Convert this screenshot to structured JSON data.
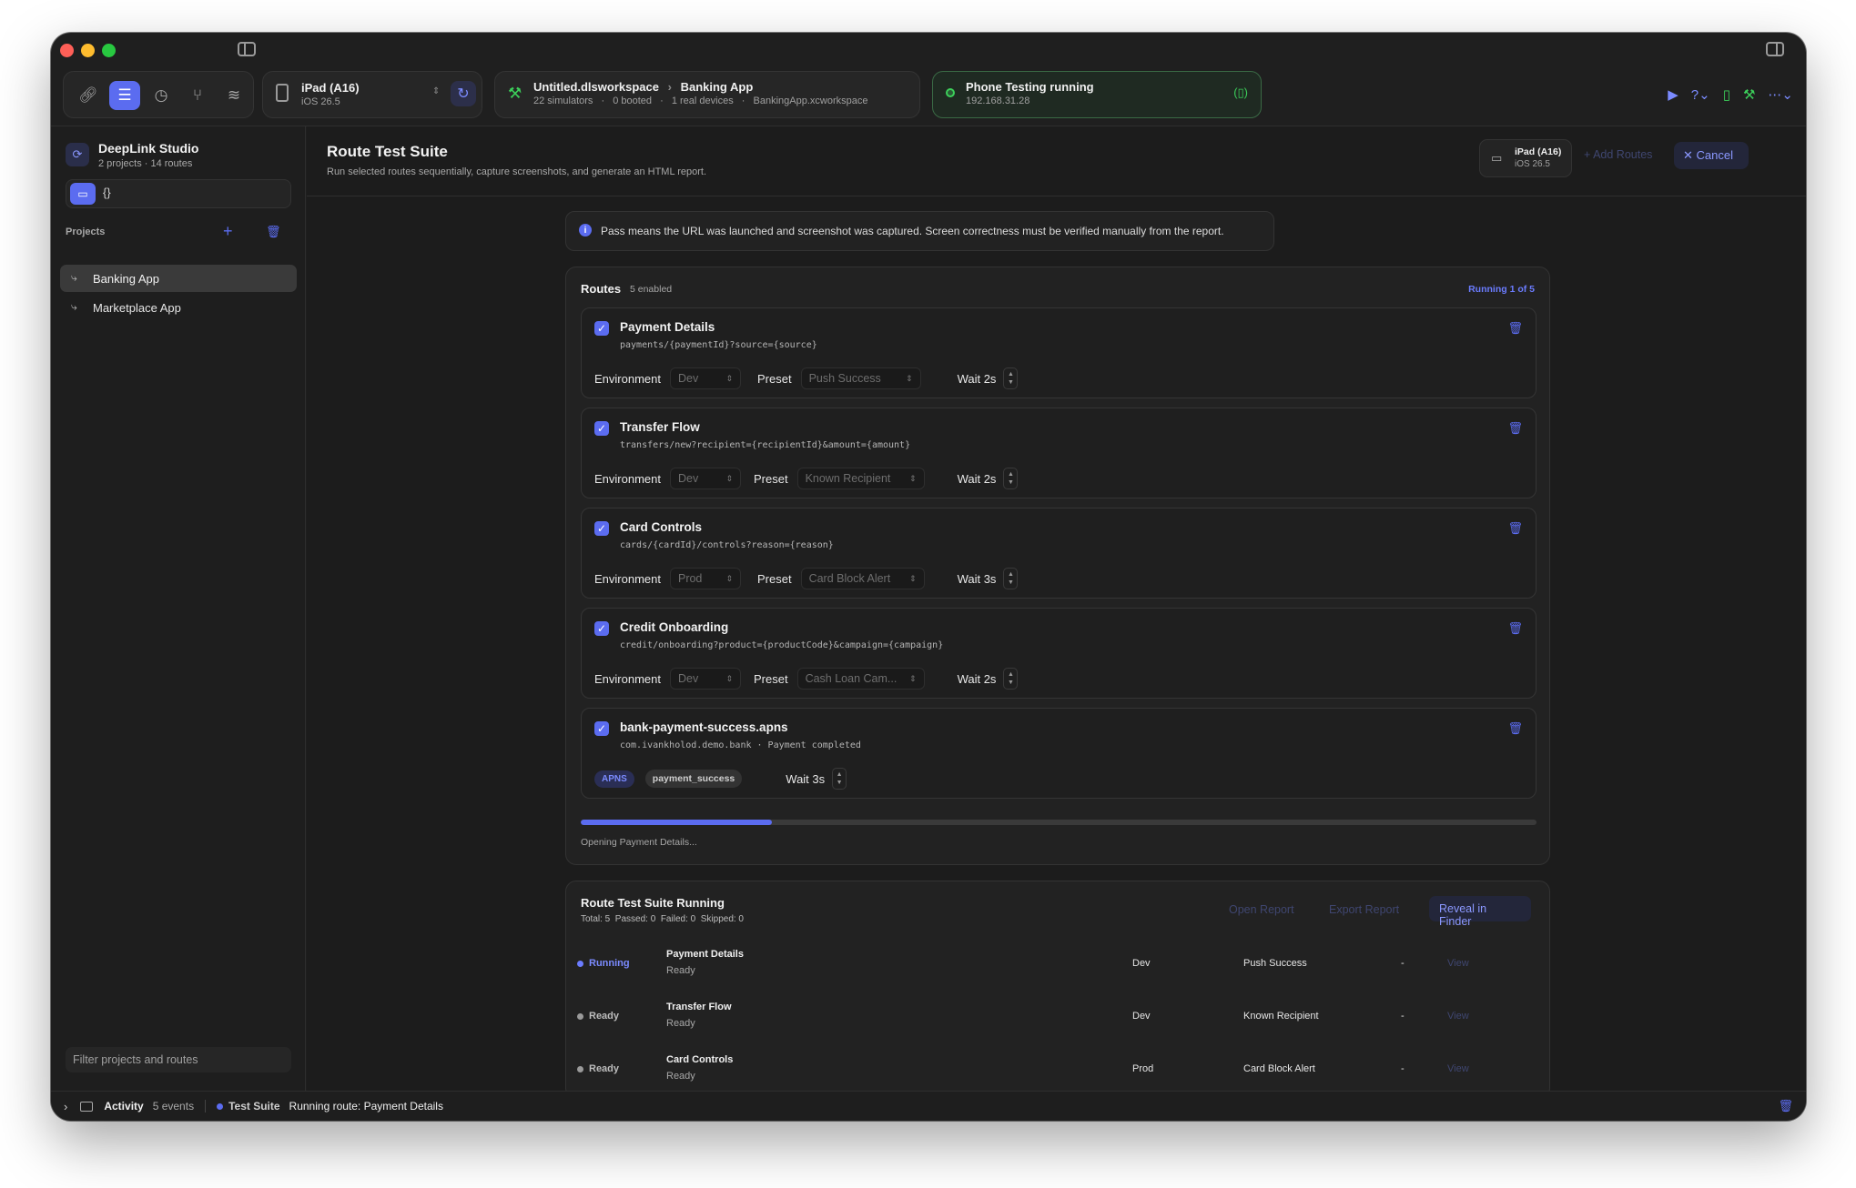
{
  "window": {
    "toolbar": {
      "device": {
        "name": "iPad (A16)",
        "os": "iOS 26.5"
      },
      "workspace": {
        "name": "Untitled.dlsworkspace",
        "project": "Banking App",
        "simulators": "22 simulators",
        "booted": "0 booted",
        "real_devices": "1 real devices",
        "xcworkspace": "BankingApp.xcworkspace"
      },
      "phone_testing": {
        "title": "Phone Testing running",
        "ip": "192.168.31.28"
      }
    }
  },
  "sidebar": {
    "app_name": "DeepLink Studio",
    "app_sub": "2 projects · 14 routes",
    "projects_label": "Projects",
    "projects": [
      {
        "label": "Banking App",
        "selected": true
      },
      {
        "label": "Marketplace App",
        "selected": false
      }
    ],
    "filter_placeholder": "Filter projects and routes",
    "mode_json_glyph": "{}"
  },
  "header": {
    "title": "Route Test Suite",
    "subtitle": "Run selected routes sequentially, capture screenshots, and generate an HTML report.",
    "device_name": "iPad (A16)",
    "device_os": "iOS 26.5",
    "add_routes": "Add Routes",
    "cancel": "Cancel"
  },
  "info_banner": "Pass means the URL was launched and screenshot was captured. Screen correctness must be verified manually from the report.",
  "routes_card": {
    "title": "Routes",
    "enabled": "5 enabled",
    "running": "Running 1 of 5",
    "labels": {
      "environment": "Environment",
      "preset": "Preset"
    },
    "routes": [
      {
        "title": "Payment Details",
        "path": "payments/{paymentId}?source={source}",
        "env": "Dev",
        "preset": "Push Success",
        "wait": "Wait 2s"
      },
      {
        "title": "Transfer Flow",
        "path": "transfers/new?recipient={recipientId}&amount={amount}",
        "env": "Dev",
        "preset": "Known Recipient",
        "wait": "Wait 2s"
      },
      {
        "title": "Card Controls",
        "path": "cards/{cardId}/controls?reason={reason}",
        "env": "Prod",
        "preset": "Card Block Alert",
        "wait": "Wait 3s"
      },
      {
        "title": "Credit Onboarding",
        "path": "credit/onboarding?product={productCode}&campaign={campaign}",
        "env": "Dev",
        "preset": "Cash Loan Cam...",
        "wait": "Wait 2s"
      }
    ],
    "apns": {
      "title": "bank-payment-success.apns",
      "bundle": "com.ivankholod.demo.bank · Payment completed",
      "tag": "APNS",
      "payload": "payment_success",
      "wait": "Wait 3s"
    },
    "progress": 0.2,
    "progress_text": "Opening Payment Details..."
  },
  "results_card": {
    "title": "Route Test Suite Running",
    "stats": "Total: 5  Passed: 0  Failed: 0  Skipped: 0",
    "open_report": "Open Report",
    "export_report": "Export Report",
    "reveal_in_finder": "Reveal in Finder",
    "rows": [
      {
        "status": "Running",
        "name": "Payment Details",
        "sub": "Ready",
        "env": "Dev",
        "preset": "Push Success",
        "dash": "-",
        "view": "View"
      },
      {
        "status": "Ready",
        "name": "Transfer Flow",
        "sub": "Ready",
        "env": "Dev",
        "preset": "Known Recipient",
        "dash": "-",
        "view": "View"
      },
      {
        "status": "Ready",
        "name": "Card Controls",
        "sub": "Ready",
        "env": "Prod",
        "preset": "Card Block Alert",
        "dash": "-",
        "view": "View"
      }
    ]
  },
  "statusbar": {
    "activity": "Activity",
    "events": "5 events",
    "test_suite": "Test Suite",
    "message": "Running route: Payment Details"
  },
  "colors": {
    "accent": "#5b6cf0",
    "green": "#3ccf5a",
    "background": "#1f1f1f"
  }
}
